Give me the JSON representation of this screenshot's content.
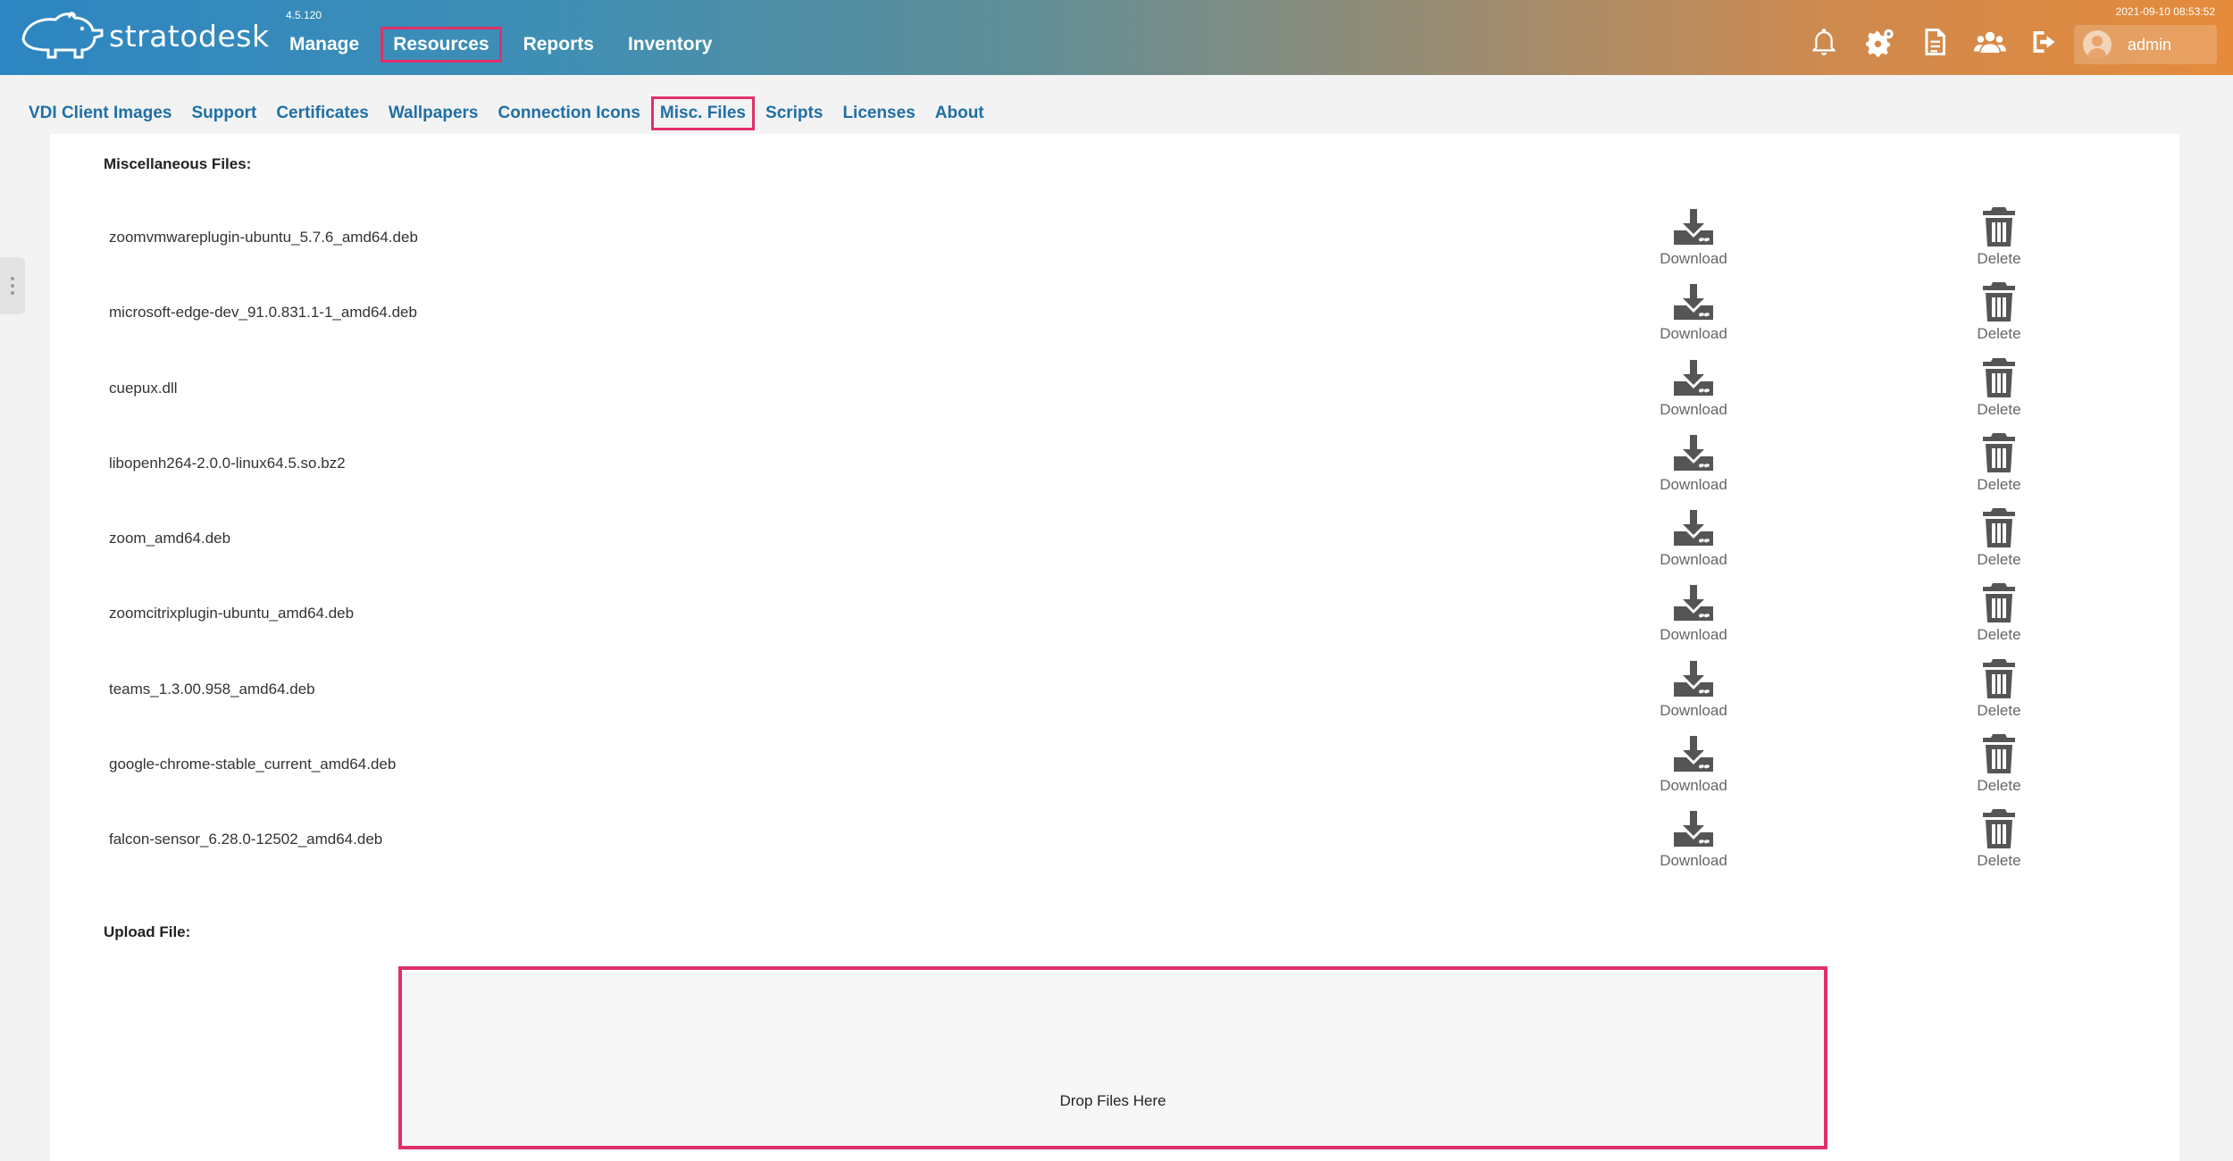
{
  "app": {
    "logo_text": "stratodesk",
    "version": "4.5.120",
    "datetime": "2021-09-10 08:53:52",
    "user": "admin"
  },
  "main_nav": [
    {
      "label": "Manage",
      "active": false
    },
    {
      "label": "Resources",
      "active": true
    },
    {
      "label": "Reports",
      "active": false
    },
    {
      "label": "Inventory",
      "active": false
    }
  ],
  "top_icons": [
    "bell-icon",
    "gears-icon",
    "document-icon",
    "users-icon",
    "logout-icon"
  ],
  "sub_nav": [
    {
      "label": "VDI Client Images",
      "active": false
    },
    {
      "label": "Support",
      "active": false
    },
    {
      "label": "Certificates",
      "active": false
    },
    {
      "label": "Wallpapers",
      "active": false
    },
    {
      "label": "Connection Icons",
      "active": false
    },
    {
      "label": "Misc. Files",
      "active": true
    },
    {
      "label": "Scripts",
      "active": false
    },
    {
      "label": "Licenses",
      "active": false
    },
    {
      "label": "About",
      "active": false
    }
  ],
  "misc": {
    "title": "Miscellaneous Files:",
    "download_label": "Download",
    "delete_label": "Delete",
    "files": [
      "zoomvmwareplugin-ubuntu_5.7.6_amd64.deb",
      "microsoft-edge-dev_91.0.831.1-1_amd64.deb",
      "cuepux.dll",
      "libopenh264-2.0.0-linux64.5.so.bz2",
      "zoom_amd64.deb",
      "zoomcitrixplugin-ubuntu_amd64.deb",
      "teams_1.3.00.958_amd64.deb",
      "google-chrome-stable_current_amd64.deb",
      "falcon-sensor_6.28.0-12502_amd64.deb"
    ]
  },
  "upload": {
    "title": "Upload File:",
    "dropzone_text": "Drop Files Here"
  },
  "colors": {
    "accent_highlight": "#e0306a",
    "link": "#1f6fa6",
    "header_start": "#2d86c2",
    "header_end": "#e58b3c"
  }
}
